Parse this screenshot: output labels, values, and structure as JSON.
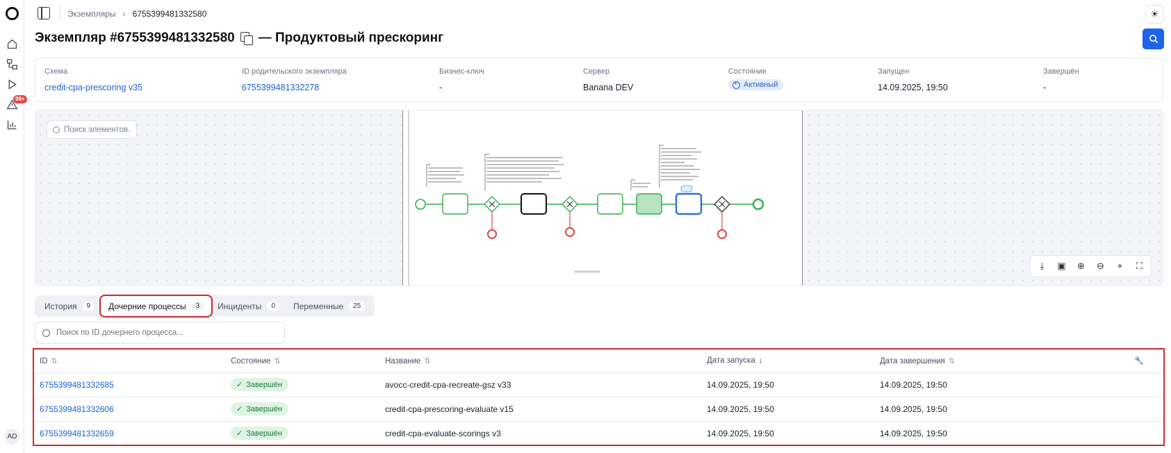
{
  "rail": {
    "badge": "99+",
    "user_initials": "AD"
  },
  "breadcrumb": {
    "parent": "Экземпляры",
    "separator": "›",
    "current": "6755399481332580"
  },
  "page": {
    "title": "Экземпляр #6755399481332580",
    "subtitle": "— Продуктовый прескоринг"
  },
  "info": {
    "schema_label": "Схема",
    "schema_value": "credit-cpa-prescoring v35",
    "parent_label": "ID родительского экземпляра",
    "parent_value": "6755399481332278",
    "key_label": "Бизнес-ключ",
    "key_value": "-",
    "server_label": "Сервер",
    "server_value": "Banana DEV",
    "state_label": "Состояние",
    "state_value": "Активный",
    "started_label": "Запущен",
    "started_value": "14.09.2025, 19:50",
    "finished_label": "Завершён",
    "finished_value": "-"
  },
  "canvas": {
    "search_placeholder": "Поиск элементов."
  },
  "tabs": [
    {
      "label": "История",
      "count": "9"
    },
    {
      "label": "Дочерние процессы",
      "count": "3"
    },
    {
      "label": "Инциденты",
      "count": "0"
    },
    {
      "label": "Переменные",
      "count": "25"
    }
  ],
  "child_search": {
    "placeholder": "Поиск по ID дочернего процесса..."
  },
  "table": {
    "headers": {
      "id": "ID",
      "state": "Состояние",
      "name": "Название",
      "start": "Дата запуска",
      "end": "Дата завершения"
    },
    "rows": [
      {
        "id": "6755399481332685",
        "state": "Завершён",
        "name": "avocc-credit-cpa-recreate-gsz v33",
        "start": "14.09.2025, 19:50",
        "end": "14.09.2025, 19:50"
      },
      {
        "id": "6755399481332606",
        "state": "Завершён",
        "name": "credit-cpa-prescoring-evaluate v15",
        "start": "14.09.2025, 19:50",
        "end": "14.09.2025, 19:50"
      },
      {
        "id": "6755399481332659",
        "state": "Завершён",
        "name": "credit-cpa-evaluate-scorings v3",
        "start": "14.09.2025, 19:50",
        "end": "14.09.2025, 19:50"
      }
    ]
  }
}
